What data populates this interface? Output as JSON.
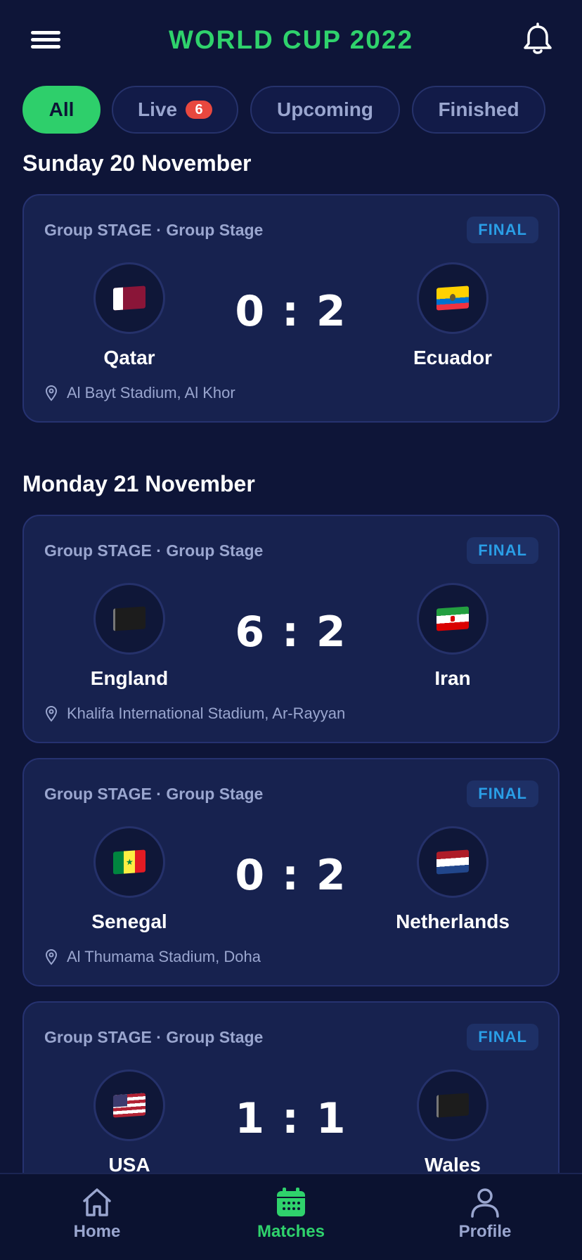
{
  "header": {
    "title": "WORLD CUP 2022",
    "menu_icon": "menu-icon",
    "bell_icon": "bell-icon",
    "accent_color": "#2fd26c"
  },
  "tabs": [
    {
      "label": "All",
      "active": true
    },
    {
      "label": "Live",
      "badge": "6"
    },
    {
      "label": "Upcoming"
    },
    {
      "label": "Finished"
    }
  ],
  "days": [
    {
      "heading": "Sunday 20 November",
      "matches": [
        {
          "stage": "Group STAGE · Group Stage",
          "status": "FINAL",
          "home": "Qatar",
          "away": "Ecuador",
          "score": "0 : 2",
          "venue": "Al Bayt Stadium, Al Khor"
        }
      ]
    },
    {
      "heading": "Monday 21 November",
      "matches": [
        {
          "stage": "Group STAGE · Group Stage",
          "status": "FINAL",
          "home": "England",
          "away": "Iran",
          "score": "6 : 2",
          "venue": "Khalifa International Stadium, Ar-Rayyan"
        },
        {
          "stage": "Group STAGE · Group Stage",
          "status": "FINAL",
          "home": "Senegal",
          "away": "Netherlands",
          "score": "0 : 2",
          "venue": "Al Thumama Stadium, Doha"
        },
        {
          "stage": "Group STAGE · Group Stage",
          "status": "FINAL",
          "home": "USA",
          "away": "Wales",
          "score": "1 : 1"
        }
      ]
    }
  ],
  "nav": [
    {
      "label": "Home",
      "icon": "home-icon"
    },
    {
      "label": "Matches",
      "icon": "calendar-icon",
      "active": true
    },
    {
      "label": "Profile",
      "icon": "user-icon"
    }
  ]
}
